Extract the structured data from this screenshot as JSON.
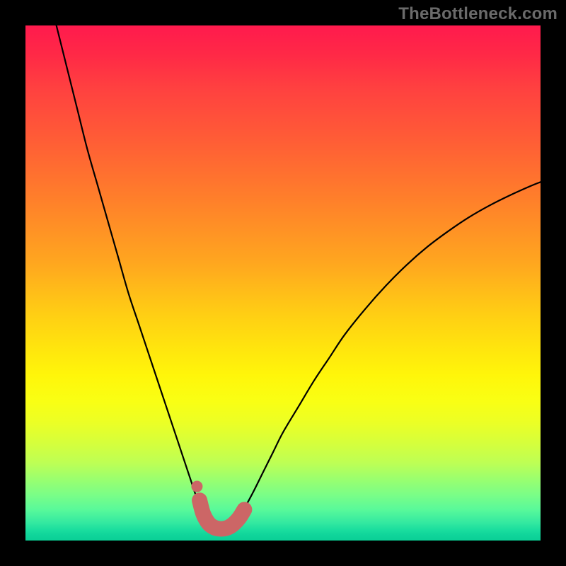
{
  "watermark": "TheBottleneck.com",
  "colors": {
    "frame": "#000000",
    "curve": "#000000",
    "highlight": "#cc6666",
    "watermark_text": "#6a6a6a"
  },
  "chart_data": {
    "type": "line",
    "title": "",
    "xlabel": "",
    "ylabel": "",
    "xlim": [
      0,
      100
    ],
    "ylim": [
      0,
      100
    ],
    "grid": false,
    "legend": null,
    "series": [
      {
        "name": "bottleneck-curve",
        "x": [
          6,
          8,
          10,
          12,
          14,
          16,
          18,
          20,
          22,
          24,
          26,
          28,
          30,
          31,
          32,
          33,
          34,
          35,
          36,
          37,
          38,
          39,
          40,
          42,
          44,
          46,
          48,
          50,
          53,
          56,
          59,
          62,
          66,
          70,
          74,
          78,
          82,
          86,
          90,
          94,
          98,
          100
        ],
        "y": [
          100,
          92,
          84,
          76,
          69,
          62,
          55,
          48,
          42,
          36,
          30,
          24,
          18,
          15,
          12,
          9,
          6.5,
          4.5,
          3.2,
          2.5,
          2.3,
          2.5,
          3.2,
          5.5,
          9,
          13,
          17,
          21,
          26,
          31,
          35.5,
          40,
          45,
          49.5,
          53.5,
          57,
          60,
          62.7,
          65,
          67,
          68.8,
          69.6
        ]
      }
    ],
    "highlight": {
      "name": "optimal-range",
      "x": [
        33.8,
        34.5,
        35.5,
        36.5,
        37.5,
        38.5,
        39.5,
        40.5,
        41.5,
        42.5
      ],
      "y": [
        7.8,
        5.2,
        3.4,
        2.6,
        2.3,
        2.3,
        2.6,
        3.3,
        4.4,
        6.0
      ],
      "lead_dot": {
        "x": 33.3,
        "y": 10.5
      }
    }
  }
}
